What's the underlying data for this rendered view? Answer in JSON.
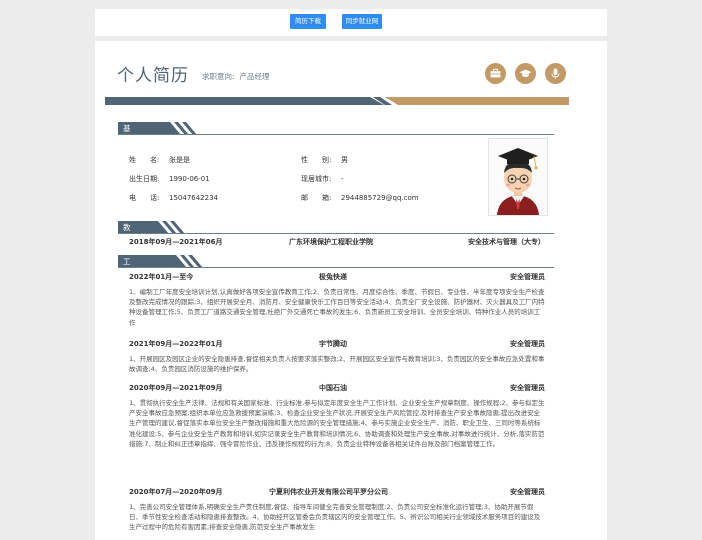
{
  "toolbar": {
    "download_label": "简历下载",
    "sync_label": "同步就业网"
  },
  "header": {
    "title": "个人简历",
    "intent_label": "求职意向:",
    "intent_value": "产品经理"
  },
  "header_icons": [
    "briefcase-icon",
    "graduation-cap-icon",
    "microphone-icon"
  ],
  "colors": {
    "accent_blue": "#4f6475",
    "accent_gold": "#c19a66",
    "button_blue": "#2f8cf0"
  },
  "sections": {
    "basic": "基本信息",
    "education": "教育经历",
    "work": "工作/实习经历"
  },
  "basic": {
    "name_label": "姓　　名:",
    "name": "张是是",
    "gender_label": "性　　别:",
    "gender": "男",
    "birth_label": "出生日期:",
    "birth": "1990-06-01",
    "city_label": "现居城市:",
    "city": "-",
    "phone_label": "电　　话:",
    "phone": "15047642234",
    "email_label": "邮　　箱:",
    "email": "2944885729@qq.com"
  },
  "education": {
    "period": "2018年09月—2021年06月",
    "school": "广东环境保护工程职业学院",
    "major": "安全技术与管理（大专）"
  },
  "jobs": [
    {
      "period": "2022年01月—至今",
      "company": "极兔快递",
      "role": "安全管理员",
      "desc": "1、编制工厂年度安全培训计划,认真做好各项安全宣传教育工作;2、负责日常性、月度综合性、季度、节假日、专业性、半年度专项安全生产检查及整改完成情况的跟踪;3、组织开展安全月、消防月、安全健康快乐工作百日等安全活动;4、负责全厂安全设施、防护器材、灭火器具及工厂内特种设备管理工作;5、负责工厂道路交通安全管理,杜绝厂外交通死亡事故的发生;6、负责新员工安全培训、全员安全培训、特种作业人员的培训工作"
    },
    {
      "period": "2021年09月—2022年01月",
      "company": "宇节腾动",
      "role": "安全管理员",
      "desc": "1、开展园区及园区企业的安全隐患排查,督促相关负责人按要求落实整改;2、开展园区安全宣传与教育培训;3、负责园区的安全事故应急处置和事故调查;4、负责园区消防设施的维护保养。"
    },
    {
      "period": "2020年09月—2021年09月",
      "company": "中国石油",
      "role": "安全管理员",
      "desc": "1、贯彻执行安全生产法律、法规和有关国家标准、行业标准,参与拟定年度安全生产工作计划、企业安全生产规章制度、操作规程;2、参与拟定生产安全事故应急预案,组织本单位应急救援预案演练;3、检查企业安全生产状况,开展安全生产风险管控,及时排查生产安全事故隐患,提出改进安全生产管理的建议,督促落实本单位安全生产整改措施和重大危险源的安全管理措施;4、参与实施企业安全生产、消防、职业卫生、三同时等系统标准化建设;5、参与企业安全生产教育和培训,如实记录安全生产教育和培训情况;6、协助调查和处理生产安全事故,对事故进行统计、分析,落实防范措施;7、制止和纠正违章指挥、强令冒险作业、违反操作规程的行为;8、负责企业特种设备各相关证件台账及部门档案管理工作。"
    },
    {
      "period": "2020年07月—2020年09月",
      "company": "宁夏利伟农业开发有限公司平罗分公司",
      "role": "安全管理员",
      "desc": "1、完善公司安全管理体系,明确安全生产责任制度,督促、指导车间健全完善安全管理制度;2、负责公司安全标准化运行管理;3、协助开展节假日、季节性安全检查活动和隐患排查整改。4、协助经开区管委会负责辖区内的安全管理工作。5、辨识公司相关行业领域技术服务项目的建设及生产过程中的危险有害因素,排查安全隐患,防范安全生产事故发生"
    }
  ]
}
